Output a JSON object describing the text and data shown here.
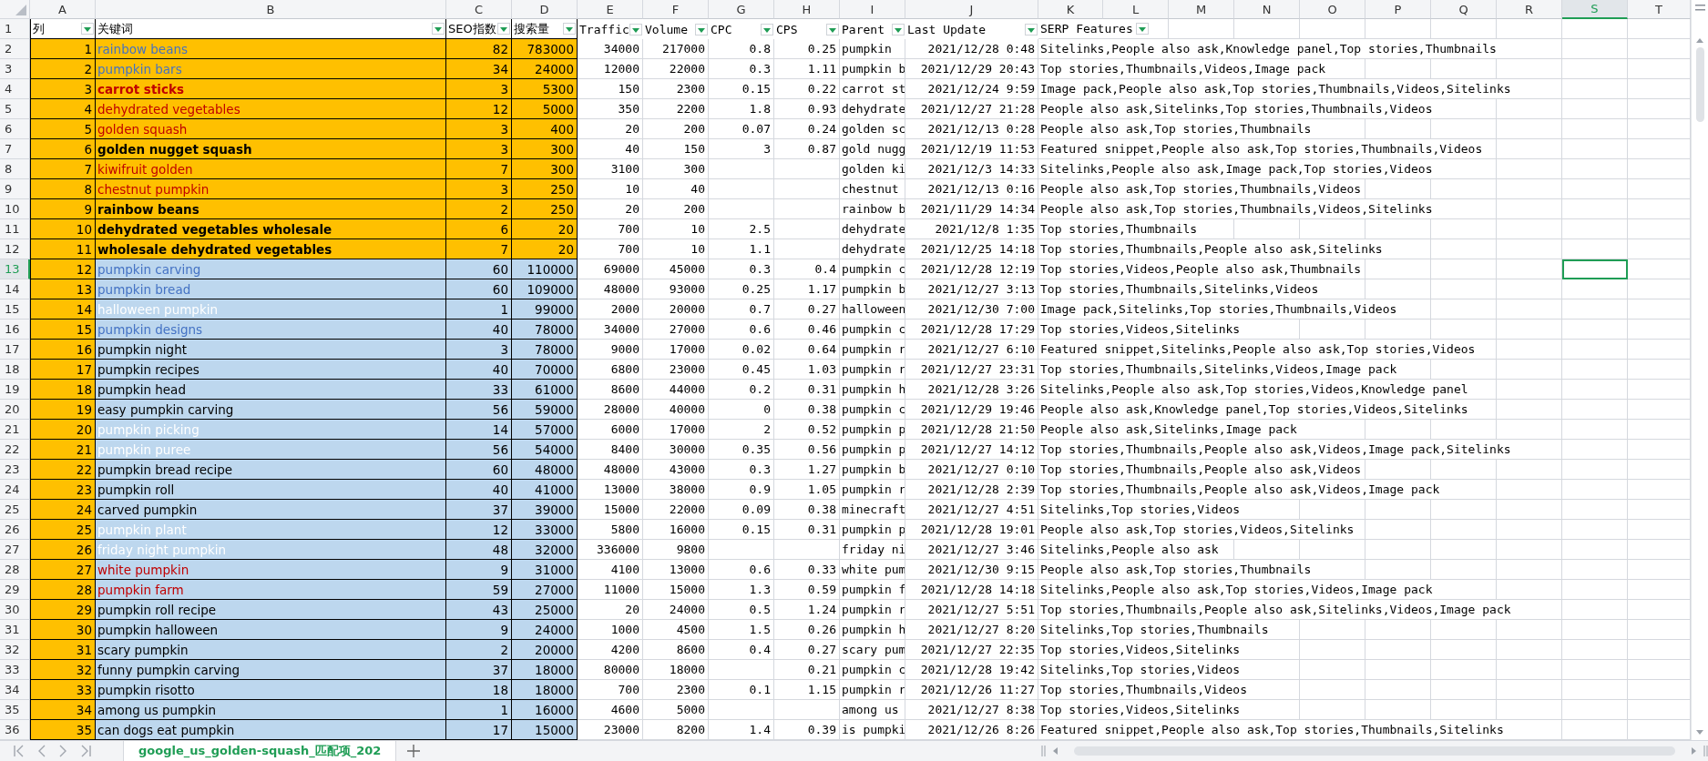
{
  "column_headers": [
    {
      "label": "A",
      "selected": false
    },
    {
      "label": "B",
      "selected": false
    },
    {
      "label": "C",
      "selected": false
    },
    {
      "label": "D",
      "selected": false
    },
    {
      "label": "E",
      "selected": false
    },
    {
      "label": "F",
      "selected": false
    },
    {
      "label": "G",
      "selected": false
    },
    {
      "label": "H",
      "selected": false
    },
    {
      "label": "I",
      "selected": false
    },
    {
      "label": "J",
      "selected": false
    },
    {
      "label": "K",
      "selected": false
    },
    {
      "label": "L",
      "selected": false
    },
    {
      "label": "M",
      "selected": false
    },
    {
      "label": "N",
      "selected": false
    },
    {
      "label": "O",
      "selected": false
    },
    {
      "label": "P",
      "selected": false
    },
    {
      "label": "Q",
      "selected": false
    },
    {
      "label": "R",
      "selected": false
    },
    {
      "label": "S",
      "selected": true
    },
    {
      "label": "T",
      "selected": false
    }
  ],
  "header_row": {
    "row_number": "1",
    "selected": false,
    "cells": [
      "列",
      "关键词",
      "SEO指数",
      "搜索量",
      "Traffic",
      "Volume",
      "CPC",
      "CPS",
      "Parent",
      "Last Update",
      "SERP Features"
    ]
  },
  "rows": [
    {
      "row_number": "2",
      "selected": false,
      "no": "1",
      "keyword": "rainbow beans",
      "color": "#4472c4",
      "bold": false,
      "kind": "orange",
      "seo": "82",
      "searches": "783000",
      "traffic": "34000",
      "volume": "217000",
      "cpc": "0.8",
      "cps": "0.25",
      "parent": "pumpkin",
      "last_update": "2021/12/28 0:48",
      "serp": "Sitelinks,People also ask,Knowledge panel,Top stories,Thumbnails"
    },
    {
      "row_number": "3",
      "selected": false,
      "no": "2",
      "keyword": "pumpkin bars",
      "color": "#4472c4",
      "bold": false,
      "kind": "orange",
      "seo": "34",
      "searches": "24000",
      "traffic": "12000",
      "volume": "22000",
      "cpc": "0.3",
      "cps": "1.11",
      "parent": "pumpkin b",
      "last_update": "2021/12/29 20:43",
      "serp": "Top stories,Thumbnails,Videos,Image pack"
    },
    {
      "row_number": "4",
      "selected": false,
      "no": "3",
      "keyword": "carrot sticks",
      "color": "#c00000",
      "bold": true,
      "kind": "orange",
      "seo": "3",
      "searches": "5300",
      "traffic": "150",
      "volume": "2300",
      "cpc": "0.15",
      "cps": "0.22",
      "parent": "carrot st",
      "last_update": "2021/12/24 9:59",
      "serp": "Image pack,People also ask,Top stories,Thumbnails,Videos,Sitelinks"
    },
    {
      "row_number": "5",
      "selected": false,
      "no": "4",
      "keyword": "dehydrated vegetables",
      "color": "#c00000",
      "bold": false,
      "kind": "orange",
      "seo": "12",
      "searches": "5000",
      "traffic": "350",
      "volume": "2200",
      "cpc": "1.8",
      "cps": "0.93",
      "parent": "dehydrate",
      "last_update": "2021/12/27 21:28",
      "serp": "People also ask,Sitelinks,Top stories,Thumbnails,Videos"
    },
    {
      "row_number": "6",
      "selected": false,
      "no": "5",
      "keyword": "golden squash",
      "color": "#c00000",
      "bold": false,
      "kind": "orange",
      "seo": "3",
      "searches": "400",
      "traffic": "20",
      "volume": "200",
      "cpc": "0.07",
      "cps": "0.24",
      "parent": "golden sc",
      "last_update": "2021/12/13 0:28",
      "serp": "People also ask,Top stories,Thumbnails"
    },
    {
      "row_number": "7",
      "selected": false,
      "no": "6",
      "keyword": "golden nugget squash",
      "color": "#000000",
      "bold": true,
      "kind": "orange",
      "seo": "3",
      "searches": "300",
      "traffic": "40",
      "volume": "150",
      "cpc": "3",
      "cps": "0.87",
      "parent": "gold nugg",
      "last_update": "2021/12/19 11:53",
      "serp": "Featured snippet,People also ask,Top stories,Thumbnails,Videos"
    },
    {
      "row_number": "8",
      "selected": false,
      "no": "7",
      "keyword": "kiwifruit golden",
      "color": "#c00000",
      "bold": false,
      "kind": "orange",
      "seo": "7",
      "searches": "300",
      "traffic": "3100",
      "volume": "300",
      "parent": "golden ki",
      "last_update": "2021/12/3 14:33",
      "serp": "Sitelinks,People also ask,Image pack,Top stories,Videos"
    },
    {
      "row_number": "9",
      "selected": false,
      "no": "8",
      "keyword": "chestnut pumpkin",
      "color": "#c00000",
      "bold": false,
      "kind": "orange",
      "seo": "3",
      "searches": "250",
      "traffic": "10",
      "volume": "40",
      "parent": "chestnut",
      "last_update": "2021/12/13 0:16",
      "serp": "People also ask,Top stories,Thumbnails,Videos"
    },
    {
      "row_number": "10",
      "selected": false,
      "no": "9",
      "keyword": "rainbow beans",
      "color": "#000000",
      "bold": true,
      "kind": "orange",
      "seo": "2",
      "searches": "250",
      "traffic": "20",
      "volume": "200",
      "parent": "rainbow b",
      "last_update": "2021/11/29 14:34",
      "serp": "People also ask,Top stories,Thumbnails,Videos,Sitelinks"
    },
    {
      "row_number": "11",
      "selected": false,
      "no": "10",
      "keyword": "dehydrated vegetables wholesale",
      "color": "#000000",
      "bold": true,
      "kind": "orange",
      "seo": "6",
      "searches": "20",
      "traffic": "700",
      "volume": "10",
      "cpc": "2.5",
      "parent": "dehydrate",
      "last_update": "2021/12/8 1:35",
      "serp": "Top stories,Thumbnails"
    },
    {
      "row_number": "12",
      "selected": false,
      "no": "11",
      "keyword": "wholesale dehydrated vegetables",
      "color": "#000000",
      "bold": true,
      "kind": "orange",
      "seo": "7",
      "searches": "20",
      "traffic": "700",
      "volume": "10",
      "cpc": "1.1",
      "parent": "dehydrate",
      "last_update": "2021/12/25 14:18",
      "serp": "Top stories,Thumbnails,People also ask,Sitelinks"
    },
    {
      "row_number": "13",
      "selected": true,
      "no": "12",
      "keyword": "pumpkin carving",
      "color": "#4472c4",
      "bold": false,
      "kind": "blue",
      "seo": "60",
      "searches": "110000",
      "traffic": "69000",
      "volume": "45000",
      "cpc": "0.3",
      "cps": "0.4",
      "parent": "pumpkin c",
      "last_update": "2021/12/28 12:19",
      "serp": "Top stories,Videos,People also ask,Thumbnails"
    },
    {
      "row_number": "14",
      "selected": false,
      "no": "13",
      "keyword": "pumpkin bread",
      "color": "#4472c4",
      "bold": false,
      "kind": "blue",
      "seo": "60",
      "searches": "109000",
      "traffic": "48000",
      "volume": "93000",
      "cpc": "0.25",
      "cps": "1.17",
      "parent": "pumpkin b",
      "last_update": "2021/12/27 3:13",
      "serp": "Top stories,Thumbnails,Sitelinks,Videos"
    },
    {
      "row_number": "15",
      "selected": false,
      "no": "14",
      "keyword": "halloween pumpkin",
      "color": "#ffffff",
      "bold": false,
      "kind": "blue",
      "seo": "1",
      "searches": "99000",
      "traffic": "2000",
      "volume": "20000",
      "cpc": "0.7",
      "cps": "0.27",
      "parent": "halloween",
      "last_update": "2021/12/30 7:00",
      "serp": "Image pack,Sitelinks,Top stories,Thumbnails,Videos"
    },
    {
      "row_number": "16",
      "selected": false,
      "no": "15",
      "keyword": "pumpkin designs",
      "color": "#4472c4",
      "bold": false,
      "kind": "blue",
      "seo": "40",
      "searches": "78000",
      "traffic": "34000",
      "volume": "27000",
      "cpc": "0.6",
      "cps": "0.46",
      "parent": "pumpkin c",
      "last_update": "2021/12/28 17:29",
      "serp": "Top stories,Videos,Sitelinks"
    },
    {
      "row_number": "17",
      "selected": false,
      "no": "16",
      "keyword": "pumpkin night",
      "color": "#000000",
      "bold": false,
      "kind": "blue",
      "seo": "3",
      "searches": "78000",
      "traffic": "9000",
      "volume": "17000",
      "cpc": "0.02",
      "cps": "0.64",
      "parent": "pumpkin r",
      "last_update": "2021/12/27 6:10",
      "serp": "Featured snippet,Sitelinks,People also ask,Top stories,Videos"
    },
    {
      "row_number": "18",
      "selected": false,
      "no": "17",
      "keyword": "pumpkin recipes",
      "color": "#000000",
      "bold": false,
      "kind": "blue",
      "seo": "40",
      "searches": "70000",
      "traffic": "6800",
      "volume": "23000",
      "cpc": "0.45",
      "cps": "1.03",
      "parent": "pumpkin r",
      "last_update": "2021/12/27 23:31",
      "serp": "Top stories,Thumbnails,Sitelinks,Videos,Image pack"
    },
    {
      "row_number": "19",
      "selected": false,
      "no": "18",
      "keyword": "pumpkin head",
      "color": "#000000",
      "bold": false,
      "kind": "blue",
      "seo": "33",
      "searches": "61000",
      "traffic": "8600",
      "volume": "44000",
      "cpc": "0.2",
      "cps": "0.31",
      "parent": "pumpkin h",
      "last_update": "2021/12/28 3:26",
      "serp": "Sitelinks,People also ask,Top stories,Videos,Knowledge panel"
    },
    {
      "row_number": "20",
      "selected": false,
      "no": "19",
      "keyword": "easy pumpkin carving",
      "color": "#000000",
      "bold": false,
      "kind": "blue",
      "seo": "56",
      "searches": "59000",
      "traffic": "28000",
      "volume": "40000",
      "cpc": "0",
      "cps": "0.38",
      "parent": "pumpkin c",
      "last_update": "2021/12/29 19:46",
      "serp": "People also ask,Knowledge panel,Top stories,Videos,Sitelinks"
    },
    {
      "row_number": "21",
      "selected": false,
      "no": "20",
      "keyword": "pumpkin picking",
      "color": "#ffffff",
      "bold": false,
      "kind": "blue",
      "seo": "14",
      "searches": "57000",
      "traffic": "6000",
      "volume": "17000",
      "cpc": "2",
      "cps": "0.52",
      "parent": "pumpkin p",
      "last_update": "2021/12/28 21:50",
      "serp": "People also ask,Sitelinks,Image pack"
    },
    {
      "row_number": "22",
      "selected": false,
      "no": "21",
      "keyword": "pumpkin puree",
      "color": "#ffffff",
      "bold": false,
      "kind": "blue",
      "seo": "56",
      "searches": "54000",
      "traffic": "8400",
      "volume": "30000",
      "cpc": "0.35",
      "cps": "0.56",
      "parent": "pumpkin p",
      "last_update": "2021/12/27 14:12",
      "serp": "Top stories,Thumbnails,People also ask,Videos,Image pack,Sitelinks"
    },
    {
      "row_number": "23",
      "selected": false,
      "no": "22",
      "keyword": "pumpkin bread recipe",
      "color": "#000000",
      "bold": false,
      "kind": "blue",
      "seo": "60",
      "searches": "48000",
      "traffic": "48000",
      "volume": "43000",
      "cpc": "0.3",
      "cps": "1.27",
      "parent": "pumpkin b",
      "last_update": "2021/12/27 0:10",
      "serp": "Top stories,Thumbnails,People also ask,Videos"
    },
    {
      "row_number": "24",
      "selected": false,
      "no": "23",
      "keyword": "pumpkin roll",
      "color": "#000000",
      "bold": false,
      "kind": "blue",
      "seo": "40",
      "searches": "41000",
      "traffic": "13000",
      "volume": "38000",
      "cpc": "0.9",
      "cps": "1.05",
      "parent": "pumpkin r",
      "last_update": "2021/12/28 2:39",
      "serp": "Top stories,Thumbnails,People also ask,Videos,Image pack"
    },
    {
      "row_number": "25",
      "selected": false,
      "no": "24",
      "keyword": "carved pumpkin",
      "color": "#000000",
      "bold": false,
      "kind": "blue",
      "seo": "37",
      "searches": "39000",
      "traffic": "15000",
      "volume": "22000",
      "cpc": "0.09",
      "cps": "0.38",
      "parent": "minecraft",
      "last_update": "2021/12/27 4:51",
      "serp": "Sitelinks,Top stories,Videos"
    },
    {
      "row_number": "26",
      "selected": false,
      "no": "25",
      "keyword": "pumpkin plant",
      "color": "#ffffff",
      "bold": false,
      "kind": "blue",
      "seo": "12",
      "searches": "33000",
      "traffic": "5800",
      "volume": "16000",
      "cpc": "0.15",
      "cps": "0.31",
      "parent": "pumpkin p",
      "last_update": "2021/12/28 19:01",
      "serp": "People also ask,Top stories,Videos,Sitelinks"
    },
    {
      "row_number": "27",
      "selected": false,
      "no": "26",
      "keyword": "friday night pumpkin",
      "color": "#ffffff",
      "bold": false,
      "kind": "blue",
      "seo": "48",
      "searches": "32000",
      "traffic": "336000",
      "volume": "9800",
      "parent": "friday ni",
      "last_update": "2021/12/27 3:46",
      "serp": "Sitelinks,People also ask"
    },
    {
      "row_number": "28",
      "selected": false,
      "no": "27",
      "keyword": "white pumpkin",
      "color": "#c00000",
      "bold": false,
      "kind": "blue",
      "seo": "9",
      "searches": "31000",
      "traffic": "4100",
      "volume": "13000",
      "cpc": "0.6",
      "cps": "0.33",
      "parent": "white pum",
      "last_update": "2021/12/30 9:15",
      "serp": "People also ask,Top stories,Thumbnails"
    },
    {
      "row_number": "29",
      "selected": false,
      "no": "28",
      "keyword": "pumpkin farm",
      "color": "#c00000",
      "bold": false,
      "kind": "blue",
      "seo": "59",
      "searches": "27000",
      "traffic": "11000",
      "volume": "15000",
      "cpc": "1.3",
      "cps": "0.59",
      "parent": "pumpkin f",
      "last_update": "2021/12/28 14:18",
      "serp": "Sitelinks,People also ask,Top stories,Videos,Image pack"
    },
    {
      "row_number": "30",
      "selected": false,
      "no": "29",
      "keyword": "pumpkin roll recipe",
      "color": "#000000",
      "bold": false,
      "kind": "blue",
      "seo": "43",
      "searches": "25000",
      "traffic": "20",
      "volume": "24000",
      "cpc": "0.5",
      "cps": "1.24",
      "parent": "pumpkin r",
      "last_update": "2021/12/27 5:51",
      "serp": "Top stories,Thumbnails,People also ask,Sitelinks,Videos,Image pack"
    },
    {
      "row_number": "31",
      "selected": false,
      "no": "30",
      "keyword": "pumpkin halloween",
      "color": "#000000",
      "bold": false,
      "kind": "blue",
      "seo": "9",
      "searches": "24000",
      "traffic": "1000",
      "volume": "4500",
      "cpc": "1.5",
      "cps": "0.26",
      "parent": "pumpkin h",
      "last_update": "2021/12/27 8:20",
      "serp": "Sitelinks,Top stories,Thumbnails"
    },
    {
      "row_number": "32",
      "selected": false,
      "no": "31",
      "keyword": "scary pumpkin",
      "color": "#000000",
      "bold": false,
      "kind": "blue",
      "seo": "2",
      "searches": "20000",
      "traffic": "4200",
      "volume": "8600",
      "cpc": "0.4",
      "cps": "0.27",
      "parent": "scary pum",
      "last_update": "2021/12/27 22:35",
      "serp": "Top stories,Videos,Sitelinks"
    },
    {
      "row_number": "33",
      "selected": false,
      "no": "32",
      "keyword": "funny pumpkin carving",
      "color": "#000000",
      "bold": false,
      "kind": "blue",
      "seo": "37",
      "searches": "18000",
      "traffic": "80000",
      "volume": "18000",
      "cps": "0.21",
      "parent": "pumpkin c",
      "last_update": "2021/12/28 19:42",
      "serp": "Sitelinks,Top stories,Videos"
    },
    {
      "row_number": "34",
      "selected": false,
      "no": "33",
      "keyword": "pumpkin risotto",
      "color": "#000000",
      "bold": false,
      "kind": "blue",
      "seo": "18",
      "searches": "18000",
      "traffic": "700",
      "volume": "2300",
      "cpc": "0.1",
      "cps": "1.15",
      "parent": "pumpkin r",
      "last_update": "2021/12/26 11:27",
      "serp": "Top stories,Thumbnails,Videos"
    },
    {
      "row_number": "35",
      "selected": false,
      "no": "34",
      "keyword": "among us pumpkin",
      "color": "#000000",
      "bold": false,
      "kind": "blue",
      "seo": "1",
      "searches": "16000",
      "traffic": "4600",
      "volume": "5000",
      "parent": "among us",
      "last_update": "2021/12/27 8:38",
      "serp": "Top stories,Videos,Sitelinks"
    },
    {
      "row_number": "36",
      "selected": false,
      "no": "35",
      "keyword": "can dogs eat pumpkin",
      "color": "#000000",
      "bold": false,
      "kind": "blue",
      "seo": "17",
      "searches": "15000",
      "traffic": "23000",
      "volume": "8200",
      "cpc": "1.4",
      "cps": "0.39",
      "parent": "is pumpki",
      "last_update": "2021/12/26 8:26",
      "serp": "Featured snippet,People also ask,Top stories,Thumbnails,Sitelinks"
    }
  ],
  "sheet_tabs": [
    {
      "label": "google_us_golden-squash_匹配项_202",
      "selected": true
    }
  ]
}
